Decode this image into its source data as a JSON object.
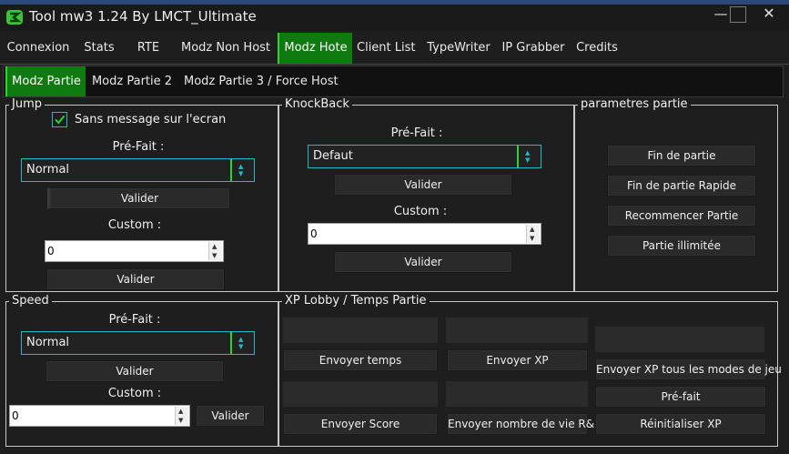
{
  "window": {
    "title": "Tool mw3 1.24 By LMCT_Ultimate",
    "controls": {
      "minimize": "—",
      "maximize": "",
      "close": "✕"
    }
  },
  "main_tabs": [
    {
      "label": "Connexion",
      "active": false
    },
    {
      "label": "Stats",
      "active": false
    },
    {
      "label": "RTE",
      "active": false
    },
    {
      "label": "Modz Non Host",
      "active": false
    },
    {
      "label": "Modz Hote",
      "active": true
    },
    {
      "label": "Client List",
      "active": false
    },
    {
      "label": "TypeWriter",
      "active": false
    },
    {
      "label": "IP Grabber",
      "active": false
    },
    {
      "label": "Credits",
      "active": false
    }
  ],
  "sub_tabs": [
    {
      "label": "Modz Partie",
      "active": true
    },
    {
      "label": "Modz Partie 2",
      "active": false
    },
    {
      "label": "Modz Partie 3 / Force Host",
      "active": false
    }
  ],
  "jump": {
    "title": "Jump",
    "checkbox_label": "Sans message sur l'ecran",
    "checked": true,
    "prefait_label": "Pré-Fait :",
    "prefait_value": "Normal",
    "valider1": "Valider",
    "custom_label": "Custom :",
    "custom_value": "0",
    "valider2": "Valider"
  },
  "knockback": {
    "title": "KnockBack",
    "prefait_label": "Pré-Fait :",
    "prefait_value": "Defaut",
    "valider1": "Valider",
    "custom_label": "Custom :",
    "custom_value": "0",
    "valider2": "Valider"
  },
  "parametres": {
    "title": "parametres partie",
    "buttons": [
      "Fin de partie",
      "Fin de partie Rapide",
      "Recommencer Partie",
      "Partie illimitée"
    ]
  },
  "speed": {
    "title": "Speed",
    "prefait_label": "Pré-Fait :",
    "prefait_value": "Normal",
    "valider1": "Valider",
    "custom_label": "Custom :",
    "custom_value": "0",
    "valider2": "Valider"
  },
  "xp": {
    "title": "XP Lobby / Temps Partie",
    "buttons": {
      "envoyer_temps": "Envoyer temps",
      "envoyer_xp": "Envoyer XP",
      "envoyer_xp_tous": "Envoyer XP tous les modes de jeu",
      "pre_fait": "Pré-fait",
      "envoyer_score": "Envoyer Score",
      "envoyer_vie": "Envoyer nombre de vie R&D",
      "reinit_xp": "Réinitialiser XP"
    }
  },
  "colors": {
    "accent_green": "#0f7a10",
    "accent_cyan": "#1ebcc8",
    "background": "#1e1e1e"
  },
  "icons": {
    "app": "app-logo-icon",
    "check": "checkmark-icon",
    "spin": "spin-arrows-icon",
    "combo": "combo-arrows-icon"
  }
}
